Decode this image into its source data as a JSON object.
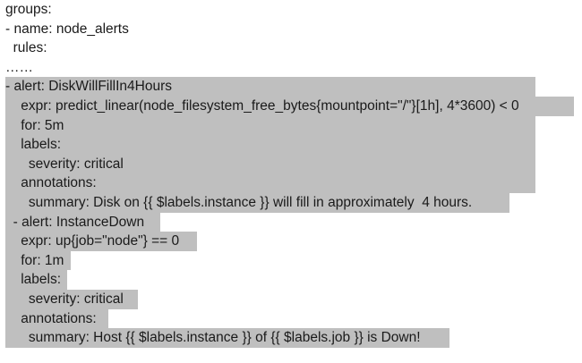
{
  "document": {
    "lines": [
      {
        "text": "groups:",
        "highlight": false
      },
      {
        "text": "- name: node_alerts",
        "highlight": false
      },
      {
        "text": "  rules:",
        "highlight": false
      },
      {
        "text": "……",
        "highlight": false
      },
      {
        "text": "- alert: DiskWillFillIn4Hours",
        "highlight": true
      },
      {
        "text": "    expr: predict_linear(node_filesystem_free_bytes{mountpoint=\"/\"}[1h], 4*3600) < 0",
        "highlight": true
      },
      {
        "text": "    for: 5m",
        "highlight": true
      },
      {
        "text": "    labels:",
        "highlight": true
      },
      {
        "text": "      severity: critical",
        "highlight": true
      },
      {
        "text": "    annotations:",
        "highlight": true
      },
      {
        "text": "      summary: Disk on {{ $labels.instance }} will fill in approximately  4 hours.",
        "highlight": true
      },
      {
        "text": "  - alert: InstanceDown",
        "highlight": true
      },
      {
        "text": "    expr: up{job=\"node\"} == 0",
        "highlight": true
      },
      {
        "text": "    for: 1m",
        "highlight": true
      },
      {
        "text": "    labels:",
        "highlight": true
      },
      {
        "text": "      severity: critical",
        "highlight": true
      },
      {
        "text": "    annotations:",
        "highlight": true
      },
      {
        "text": "      summary: Host {{ $labels.instance }} of {{ $labels.job }} is Down!",
        "highlight": true
      }
    ],
    "highlight_color": "#bfbfbf",
    "spellcheck_color": "#c0504d"
  }
}
